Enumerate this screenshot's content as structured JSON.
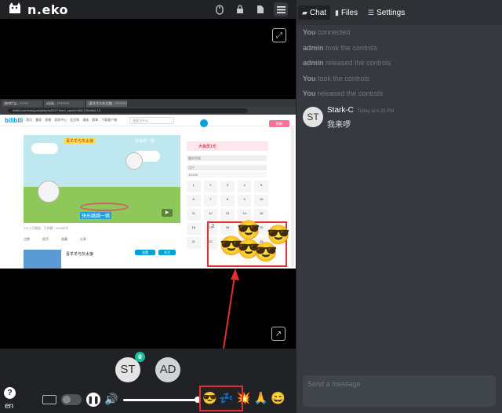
{
  "app": {
    "logo_text": "n.eko",
    "logo_icon": "cat-icon"
  },
  "topbar": {
    "icons": [
      "mouse-icon",
      "lock-icon",
      "file-icon",
      "menu-icon"
    ]
  },
  "shared_browser": {
    "tabs": [
      "[咖啡厅][] - ?????",
      "[动画] - ???????",
      "[喜羊羊与灰太狼] - ???????"
    ],
    "url": "bilibili.com/bangumi/play/ss6247?from_spmid=666.3.flexible.13",
    "logo": "bilibili",
    "nav": [
      "首页",
      "番剧",
      "直播",
      "游戏中心",
      "会员购",
      "漫画",
      "赛事",
      "下载客户端"
    ],
    "search_placeholder": "搜索点什么",
    "upload_label": "投稿",
    "video_caption_1": "喜羊羊与灰太狼",
    "video_caption_2": "快来跳一跳",
    "sticker_text": "快乐跳跳一跳",
    "video_meta": "222.3万播放 · 万弹幕 · 94%好评",
    "actions": [
      "点赞",
      "投币",
      "收藏",
      "分享"
    ],
    "rec_title": "喜羊羊与灰太狼",
    "rec_buttons": [
      "追番",
      "关注"
    ],
    "promo_text": "大会员1元",
    "side_labels": [
      "缓存列表",
      "正片",
      "10/100"
    ],
    "calendar": [
      "1",
      "2",
      "3",
      "4",
      "5",
      "6",
      "7",
      "8",
      "9",
      "10",
      "11",
      "12",
      "13",
      "14",
      "15",
      "16",
      "17",
      "18",
      "19",
      "20",
      "21",
      "22",
      "23",
      "24",
      "25"
    ],
    "emoji_text": "2"
  },
  "video": {
    "fullscreen_icon": "fullscreen-icon",
    "popout_icon": "popout-icon"
  },
  "members": [
    {
      "initials": "ST",
      "badge": "host-icon"
    },
    {
      "initials": "AD"
    }
  ],
  "controls": {
    "help_label": "?",
    "lang": "en",
    "pause_glyph": "❚❚",
    "volume_glyph": "🔊",
    "volume_level": 0.96,
    "emoji_buttons": [
      "😎",
      "💤",
      "💥",
      "🙏",
      "😄"
    ]
  },
  "sidebar": {
    "tabs": [
      {
        "label": "Chat",
        "icon": "chat-icon",
        "active": true
      },
      {
        "label": "Files",
        "icon": "file-icon",
        "active": false
      },
      {
        "label": "Settings",
        "icon": "sliders-icon",
        "active": false
      }
    ],
    "log": [
      {
        "who": "You",
        "text": "connected"
      },
      {
        "who": "admin",
        "text": "took the controls"
      },
      {
        "who": "admin",
        "text": "released the controls"
      },
      {
        "who": "You",
        "text": "took the controls"
      },
      {
        "who": "You",
        "text": "released the controls"
      }
    ],
    "message": {
      "avatar": "ST",
      "user": "Stark-C",
      "time": "Today at 6:26 PM",
      "text": "我来啰"
    },
    "input_placeholder": "Send a message"
  },
  "colors": {
    "sidebar_bg": "#36393f",
    "bar_bg": "#202225",
    "highlight": "#e03030",
    "badge": "#19bd9c"
  }
}
